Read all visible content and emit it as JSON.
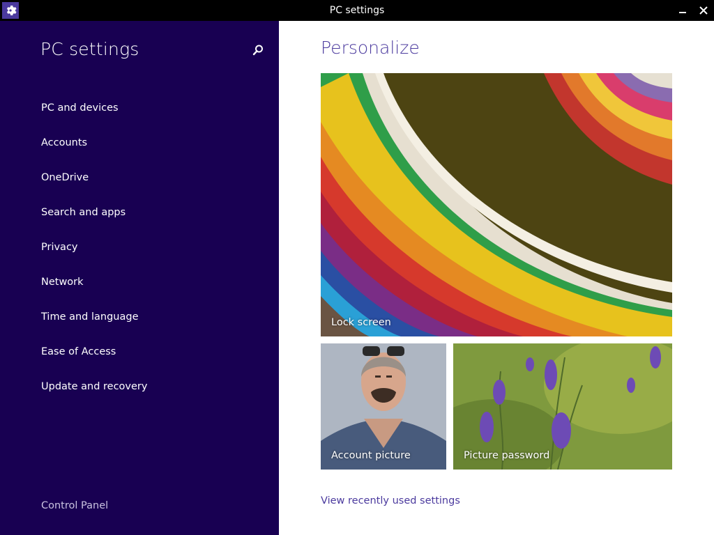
{
  "window": {
    "title": "PC settings",
    "icon": "gear-icon",
    "controls": [
      "minimize-icon",
      "close-icon"
    ]
  },
  "sidebar": {
    "title": "PC settings",
    "search_icon": "search-icon",
    "items": [
      {
        "label": "PC and devices"
      },
      {
        "label": "Accounts"
      },
      {
        "label": "OneDrive"
      },
      {
        "label": "Search and apps"
      },
      {
        "label": "Privacy"
      },
      {
        "label": "Network"
      },
      {
        "label": "Time and language"
      },
      {
        "label": "Ease of Access"
      },
      {
        "label": "Update and recovery"
      }
    ],
    "footer_link": "Control Panel"
  },
  "main": {
    "title": "Personalize",
    "tiles": {
      "lock_screen": "Lock screen",
      "account_picture": "Account picture",
      "picture_password": "Picture password"
    },
    "recent_link": "View recently used settings"
  },
  "colors": {
    "sidebar_bg": "#180052",
    "accent": "#4b3a9e",
    "titlebar_bg": "#000000"
  }
}
